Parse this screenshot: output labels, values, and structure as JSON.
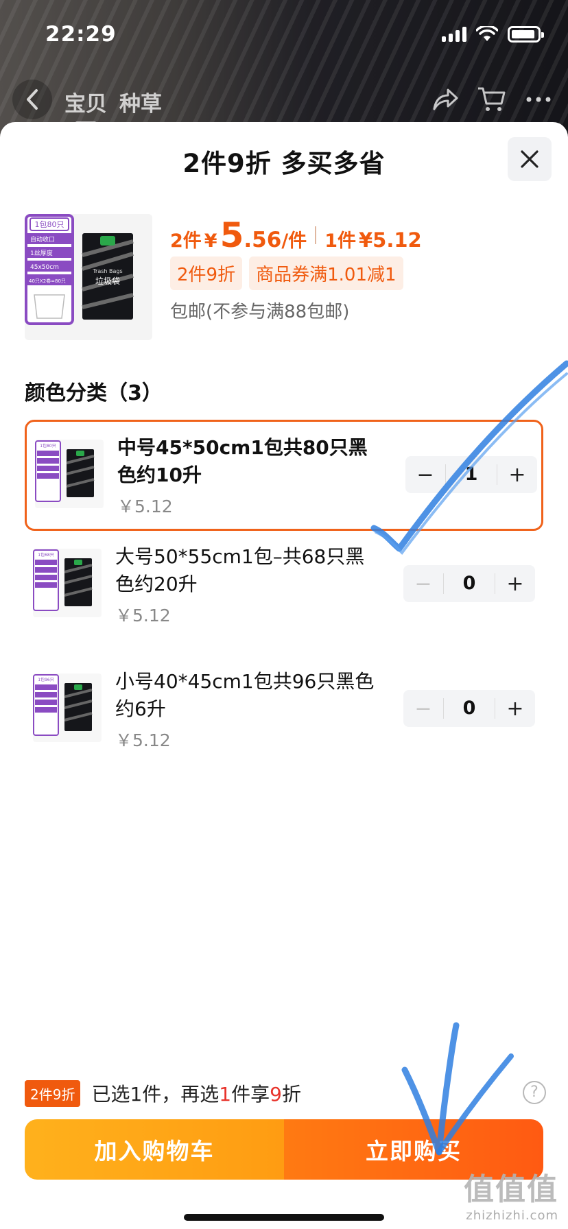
{
  "status_bar": {
    "time": "22:29"
  },
  "nav": {
    "tabs": [
      "宝贝",
      "种草"
    ]
  },
  "sheet": {
    "title": "2件9折 多买多省",
    "product": {
      "price_prefix": "2件",
      "price_symbol": "¥",
      "price_big": "5",
      "price_decimal": ".56",
      "price_unit": "/件",
      "single_prefix": "1件",
      "single_price": "¥5.12",
      "tags": [
        "2件9折",
        "商品券满1.01减1"
      ],
      "shipping": "包邮(不参与满88包邮)",
      "thumb": {
        "pack_label": "1包80只",
        "specs": [
          "自动收口",
          "1丝厚度",
          "45x50cm",
          "40只X2卷=80只"
        ],
        "bag_en": "Trash Bags",
        "bag_cn": "垃圾袋"
      }
    },
    "section_title": "颜色分类（3）",
    "skus": [
      {
        "name": "中号45*50cm1包共80只黑色约10升",
        "price": "￥5.12",
        "qty": "1",
        "selected": true,
        "thumb_label": "1包80只"
      },
      {
        "name": "大号50*55cm1包–共68只黑色约20升",
        "price": "￥5.12",
        "qty": "0",
        "selected": false,
        "thumb_label": "1包68只"
      },
      {
        "name": "小号40*45cm1包共96只黑色约6升",
        "price": "￥5.12",
        "qty": "0",
        "selected": false,
        "thumb_label": "1包96只"
      }
    ],
    "stepper_labels": {
      "minus": "−",
      "plus": "+"
    },
    "promo": {
      "badge": "2件9折",
      "text_a": "已选1件，再选",
      "text_num": "1",
      "text_b": "件享",
      "text_discount": "9",
      "text_c": "折",
      "help": "?"
    },
    "actions": {
      "add_to_cart": "加入购物车",
      "buy_now": "立即购买"
    }
  },
  "watermark": {
    "big": "值值值",
    "small": "zhizhizhi.com"
  },
  "colors": {
    "accent": "#f05a0e",
    "cart": "#ffa816",
    "buy": "#ff6612",
    "annotation": "#2f7fe0"
  }
}
